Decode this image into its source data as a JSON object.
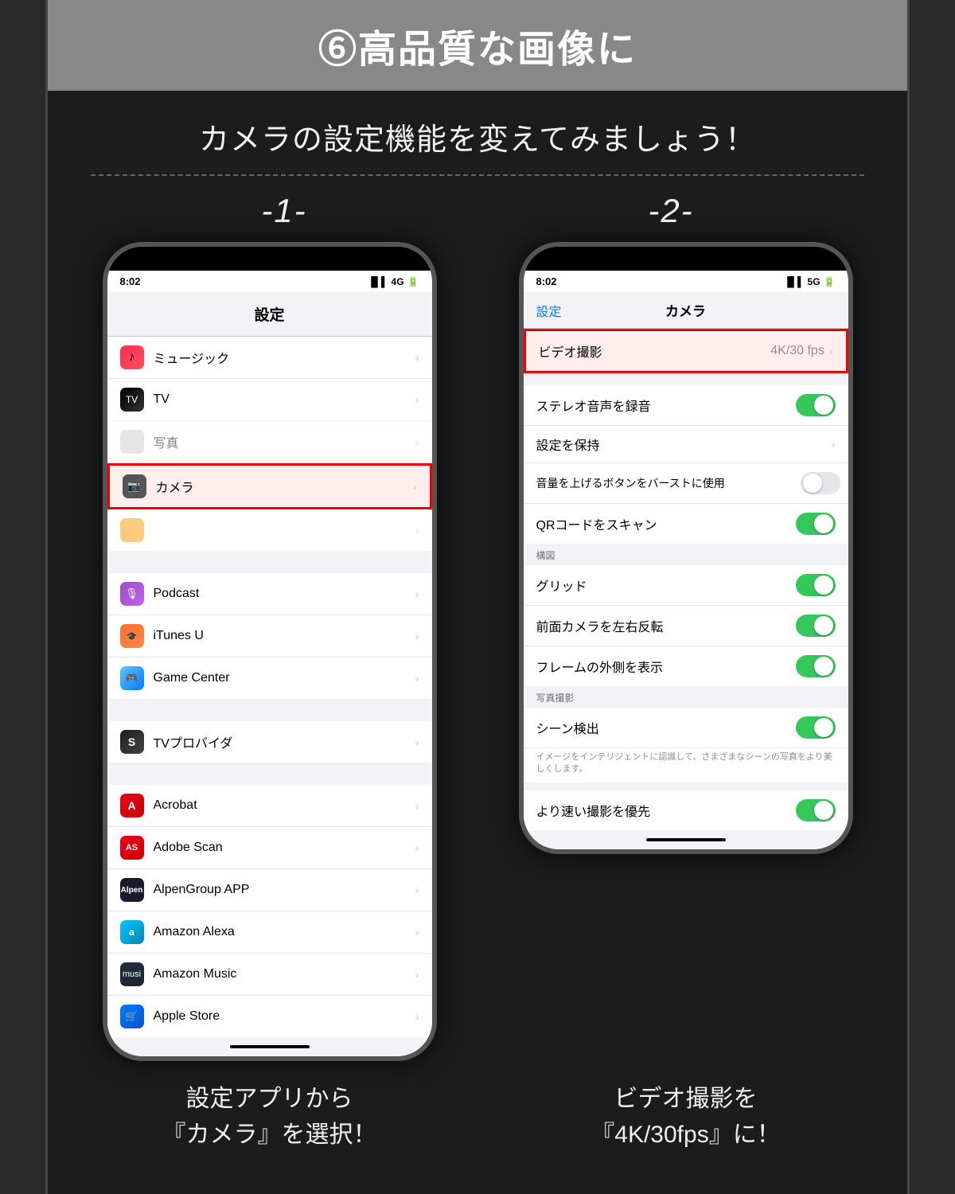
{
  "header": {
    "title": "⑥高品質な画像に"
  },
  "subtitle": "カメラの設定機能を変えてみましょう！",
  "step1": {
    "label": "-1-",
    "caption_line1": "設定アプリから",
    "caption_line2": "『カメラ』を選択！"
  },
  "step2": {
    "label": "-2-",
    "caption_line1": "ビデオ撮影を",
    "caption_line2": "『4K/30fps』に！"
  },
  "phone1": {
    "status_time": "8:02",
    "status_signal": "4G",
    "screen_title": "設定",
    "items": [
      {
        "label": "ミュージック",
        "icon": "music"
      },
      {
        "label": "TV",
        "icon": "tv"
      },
      {
        "label": "カメラ",
        "icon": "camera",
        "highlight": true
      },
      {
        "label": "Podcast",
        "icon": "podcast"
      },
      {
        "label": "iTunes U",
        "icon": "itunesu"
      },
      {
        "label": "Game Center",
        "icon": "gamecenter"
      },
      {
        "label": "TVプロバイダ",
        "icon": "tvprovider"
      },
      {
        "label": "Acrobat",
        "icon": "acrobat"
      },
      {
        "label": "Adobe Scan",
        "icon": "adobescan"
      },
      {
        "label": "AlpenGroup APP",
        "icon": "alpengroup"
      },
      {
        "label": "Amazon Alexa",
        "icon": "amazon-alexa"
      },
      {
        "label": "Amazon Music",
        "icon": "amazon-music"
      },
      {
        "label": "Apple Store",
        "icon": "apple-store"
      }
    ]
  },
  "phone2": {
    "status_time": "8:02",
    "status_signal": "5G",
    "nav_back": "設定",
    "nav_title": "カメラ",
    "video_section": {
      "label": "ビデオ撮影",
      "value": "4K/30 fps"
    },
    "items": [
      {
        "label": "ステレオ音声を録音",
        "type": "toggle_on"
      },
      {
        "label": "設定を保持",
        "type": "chevron"
      },
      {
        "label": "音量を上げるボタンをバーストに使用",
        "type": "toggle_off"
      },
      {
        "label": "QRコードをスキャン",
        "type": "toggle_on"
      }
    ],
    "composition_section": "構図",
    "composition_items": [
      {
        "label": "グリッド",
        "type": "toggle_on"
      },
      {
        "label": "前面カメラを左右反転",
        "type": "toggle_on"
      },
      {
        "label": "フレームの外側を表示",
        "type": "toggle_on"
      }
    ],
    "photo_section": "写真撮影",
    "photo_items": [
      {
        "label": "シーン検出",
        "type": "toggle_on"
      },
      {
        "label": "イメージをインテリジェントに認識して、さまざまなシーンの写真をより美しくします。",
        "type": "description"
      }
    ],
    "bottom_item": "より速い撮影を優先"
  },
  "icons": {
    "music": "♪",
    "tv": "▶",
    "camera": "📷",
    "podcast": "🎙",
    "itunesu": "🎓",
    "gamecenter": "🎮",
    "tvprovider": "S",
    "acrobat": "A",
    "adobescan": "A",
    "alpengroup": "A",
    "amazon-alexa": "a",
    "amazon-music": "♪",
    "apple-store": "A"
  }
}
